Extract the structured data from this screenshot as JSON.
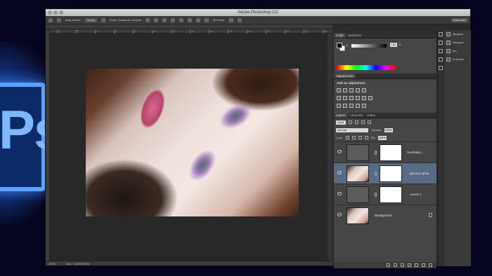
{
  "app": {
    "title": "Adobe Photoshop CC"
  },
  "options_bar": {
    "auto_select_label": "Auto-Select:",
    "auto_select_value": "Group",
    "show_transform_label": "Show Transform Controls",
    "mode_label": "3D Mode:",
    "workspace": "Essentials"
  },
  "document": {
    "ruler_ticks": [
      "0",
      "2",
      "4",
      "6",
      "8",
      "10",
      "12",
      "14",
      "16",
      "18",
      "20",
      "22",
      "24",
      "26",
      "28"
    ],
    "zoom": "100%",
    "doc_info": "Doc: 1.54M/4.95M"
  },
  "color_panel": {
    "tabs": [
      "Color",
      "Swatches"
    ],
    "channel_label": "K",
    "value": "100",
    "unit": "%"
  },
  "adjustments_panel": {
    "tabs": [
      "Adjustments"
    ],
    "title": "Add an adjustment"
  },
  "layers_panel": {
    "tabs": [
      "Layers",
      "Channels",
      "Paths"
    ],
    "kind_label": "Kind",
    "blend_mode": "Normal",
    "opacity_label": "Opacity:",
    "opacity_value": "100%",
    "lock_label": "Lock:",
    "fill_label": "Fill:",
    "fill_value": "100%",
    "layers": [
      {
        "name": "Hue/Satur...",
        "selected": false
      },
      {
        "name": "glamour-glow",
        "selected": true
      },
      {
        "name": "Levels 1",
        "selected": false
      },
      {
        "name": "Background",
        "selected": false
      }
    ]
  },
  "mini_panels": {
    "items": [
      "Navigator",
      "Histogram",
      "Info",
      "Properties"
    ]
  },
  "icons": {
    "eye": "eye-icon",
    "lock": "lock-icon",
    "chain": "chain-link-icon"
  },
  "colors": {
    "panel_bg": "#454545",
    "selected_layer": "#596b84",
    "brand": "#5aa2ff"
  }
}
